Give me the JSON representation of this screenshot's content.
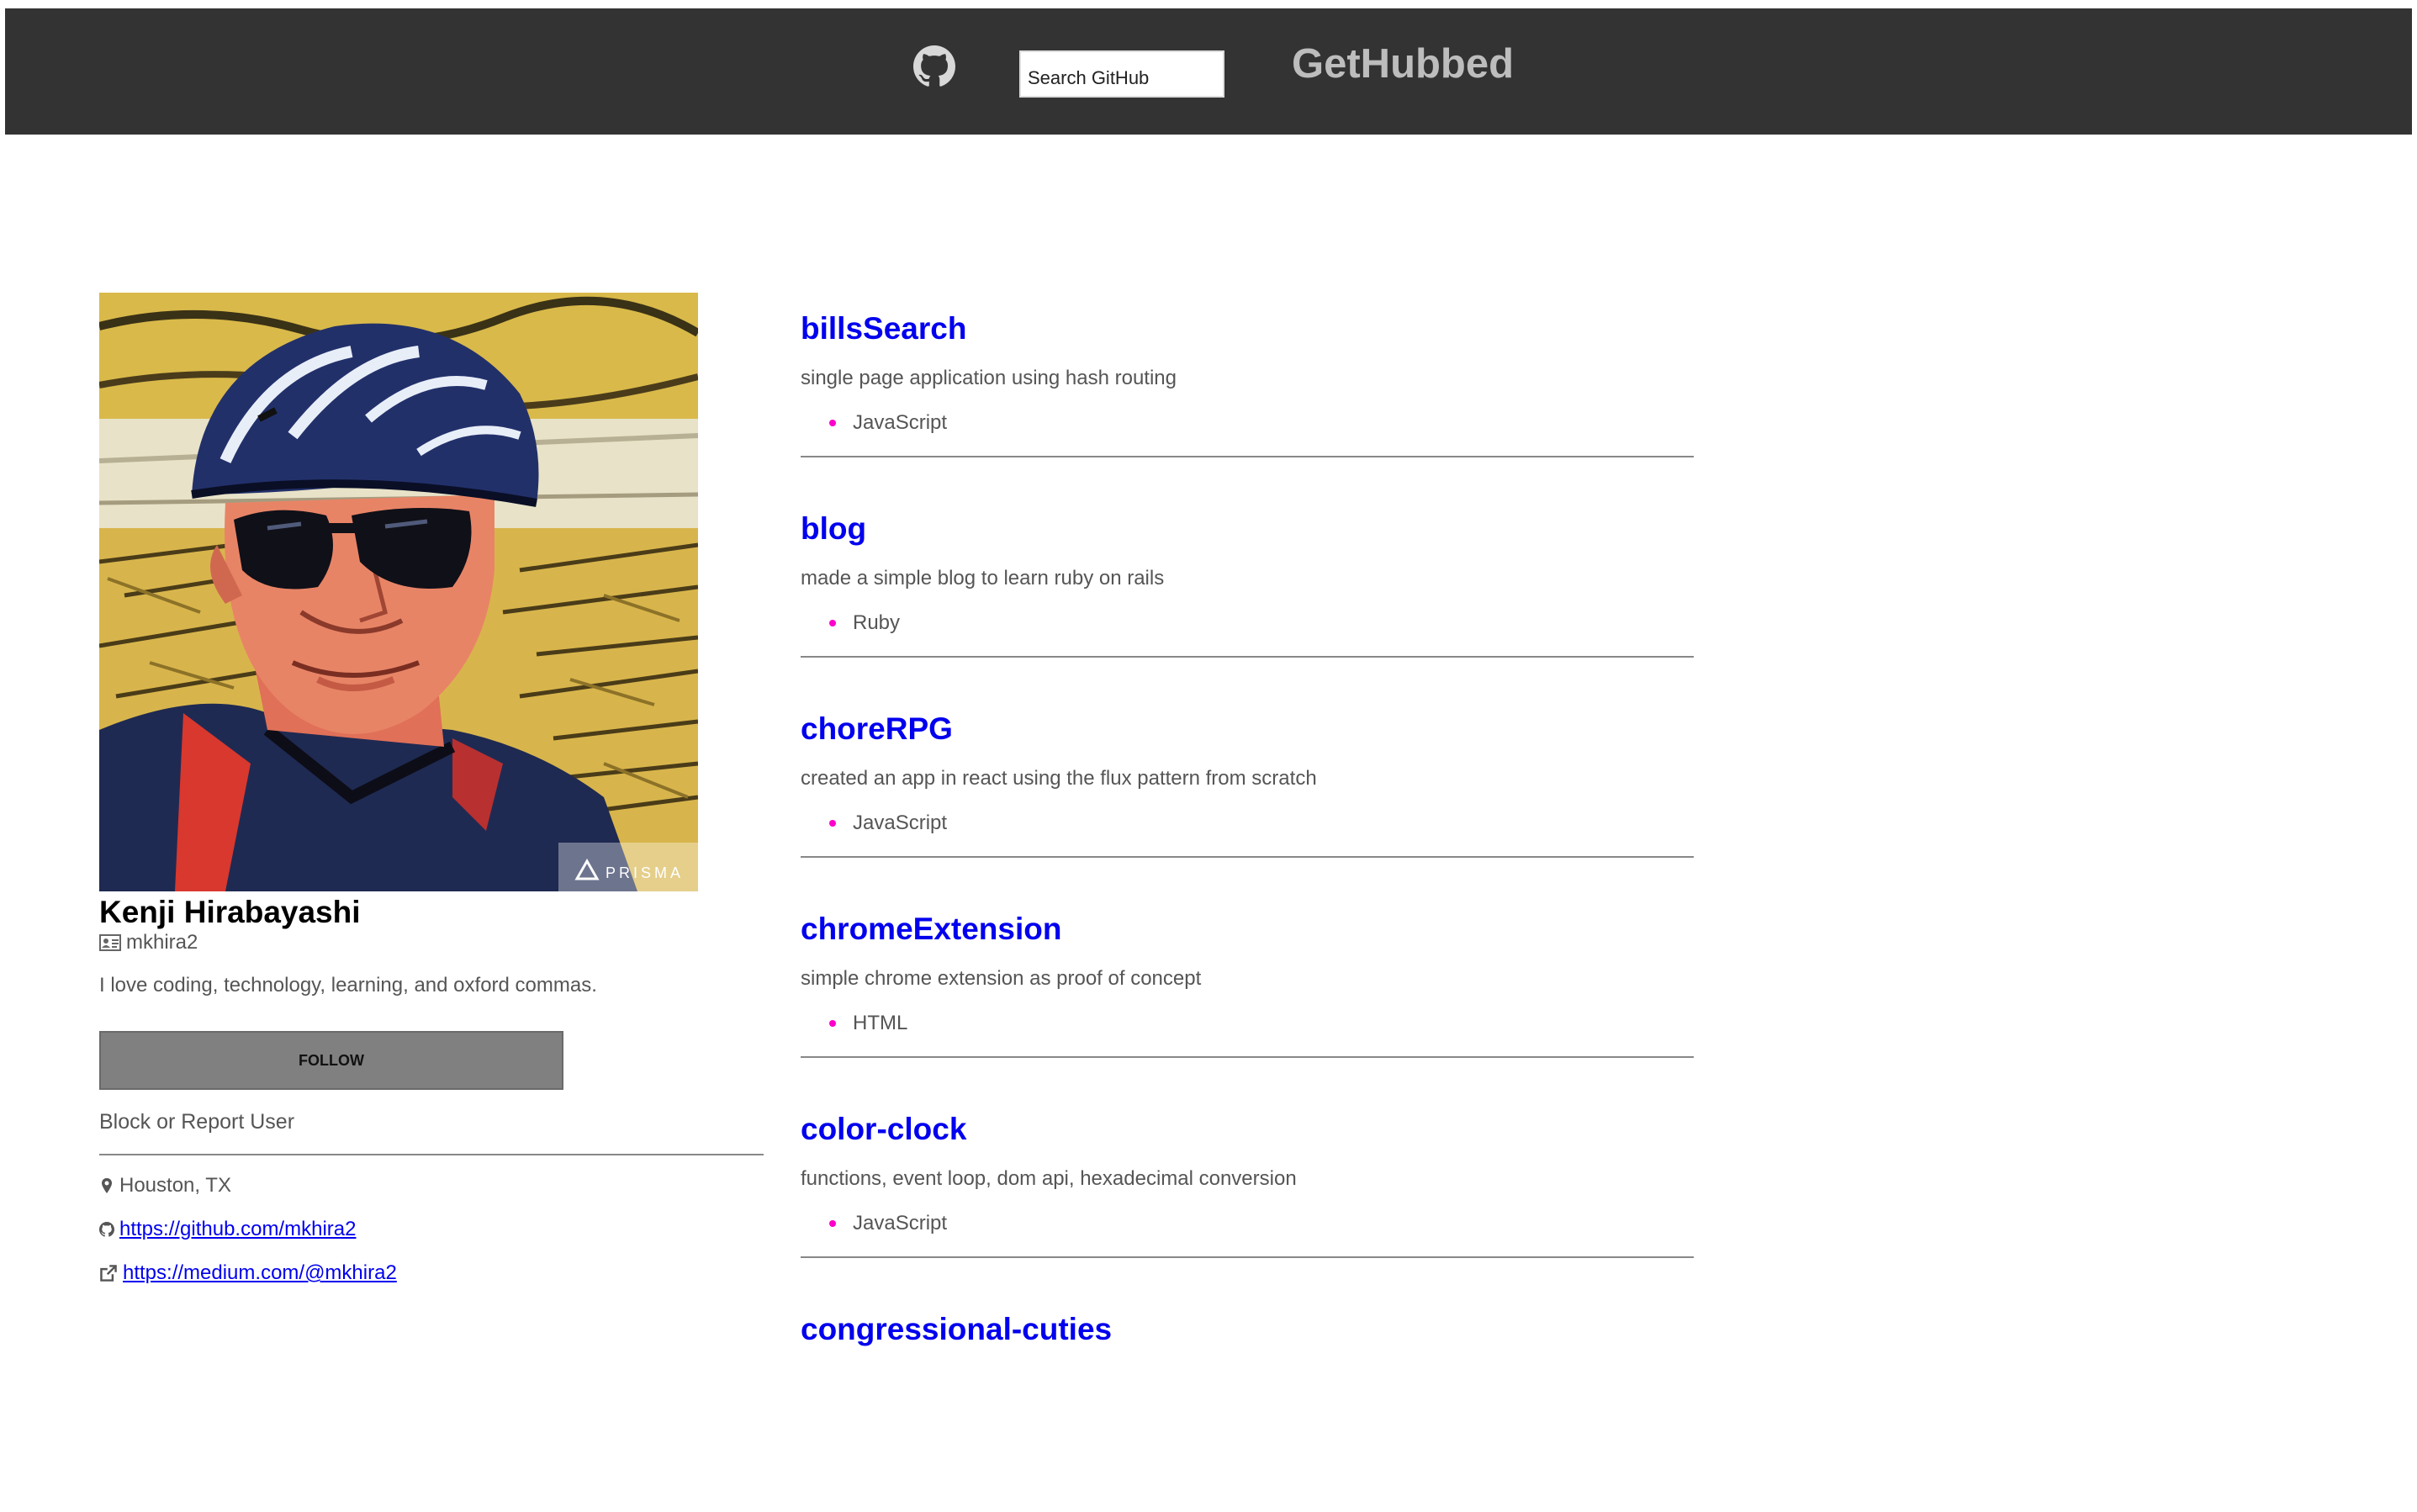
{
  "header": {
    "search_placeholder": "Search GitHub",
    "brand": "GetHubbed",
    "github_icon": "github-octocat-icon"
  },
  "profile": {
    "avatar_watermark": "PRISMA",
    "name": "Kenji Hirabayashi",
    "login": "mkhira2",
    "bio": "I love coding, technology, learning, and oxford commas.",
    "follow_label": "FOLLOW",
    "report_label": "Block or Report User",
    "location": "Houston, TX",
    "github_url": "https://github.com/mkhira2",
    "website_url": "https://medium.com/@mkhira2",
    "icons": {
      "login": "id-card-icon",
      "location": "map-marker-icon",
      "github": "github-icon",
      "website": "external-link-icon"
    }
  },
  "repos": [
    {
      "name": "billsSearch",
      "description": "single page application using hash routing",
      "language": "JavaScript"
    },
    {
      "name": "blog",
      "description": "made a simple blog to learn ruby on rails",
      "language": "Ruby"
    },
    {
      "name": "choreRPG",
      "description": "created an app in react using the flux pattern from scratch",
      "language": "JavaScript"
    },
    {
      "name": "chromeExtension",
      "description": "simple chrome extension as proof of concept",
      "language": "HTML"
    },
    {
      "name": "color-clock",
      "description": "functions, event loop, dom api, hexadecimal conversion",
      "language": "JavaScript"
    },
    {
      "name": "congressional-cuties"
    }
  ],
  "colors": {
    "header_bg": "#333333",
    "brand_text": "#bdbdbd",
    "link": "#0000ee",
    "language_dot": "#ff00cc",
    "follow_bg": "#808080"
  }
}
